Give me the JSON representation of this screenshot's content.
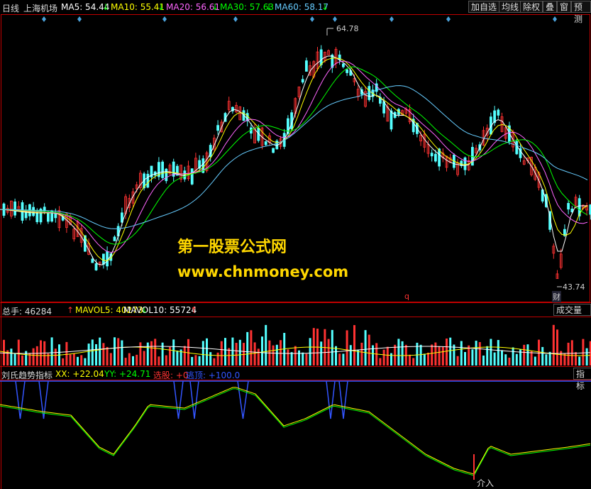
{
  "header": {
    "period": "日线",
    "stock": "上海机场",
    "ma5": "MA5: 54.44",
    "ma10": "MA10: 55.41",
    "ma20": "MA20: 56.61",
    "ma30": "MA30: 57.63",
    "ma60": "MA60: 58.17",
    "arrow_down": "↓",
    "buttons": [
      "加自选",
      "均线",
      "除权",
      "叠",
      "窗",
      "预测"
    ]
  },
  "price_panel": {
    "high_label": "64.78",
    "low_label": "43.74",
    "marker_q": "q",
    "marker_cai": "财"
  },
  "watermark": {
    "line1": "第一股票公式网",
    "line2": "www.chnmoney.com"
  },
  "volume_panel": {
    "total": "总手: 46284",
    "mavol5": "MAVOL5: 40273",
    "mavol10": "MAVOL10: 55724",
    "up_arrow": "↑",
    "down_arrow": "↓",
    "button": "成交量"
  },
  "indicator_panel": {
    "name": "刘氏趋势指标",
    "xx": "XX: +22.04",
    "yy": "YY: +24.71",
    "select": "选股: +0",
    "escape": "逃顶: +100.0",
    "button": "指标",
    "buy_label": "介入"
  },
  "colors": {
    "ma5": "#ffffff",
    "ma10": "#ffff00",
    "ma20": "#ff66ff",
    "ma30": "#00ff00",
    "ma60": "#66ccff",
    "up": "#ff3232",
    "down": "#54ffff",
    "frame": "#c00000"
  }
}
